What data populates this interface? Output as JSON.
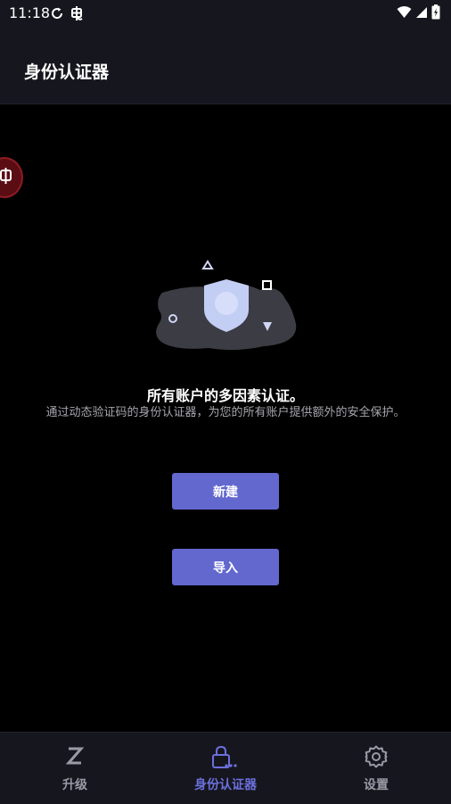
{
  "status_bar": {
    "time": "11:18"
  },
  "app_bar": {
    "title": "身份认证器"
  },
  "empty_state": {
    "title": "所有账户的多因素认证。",
    "description": "通过动态验证码的身份认证器，为您的所有账户提供额外的安全保护。"
  },
  "actions": {
    "new_label": "新建",
    "import_label": "导入"
  },
  "bottom_nav": {
    "items": [
      {
        "label": "升级",
        "icon": "z-logo-icon"
      },
      {
        "label": "身份认证器",
        "icon": "lock-key-icon",
        "active": true
      },
      {
        "label": "设置",
        "icon": "gear-icon"
      }
    ]
  },
  "colors": {
    "accent": "#6368cf",
    "active_nav": "#6b70dc",
    "background": "#000000",
    "bar_background": "#16161e",
    "muted_text": "#a6a6ae"
  }
}
